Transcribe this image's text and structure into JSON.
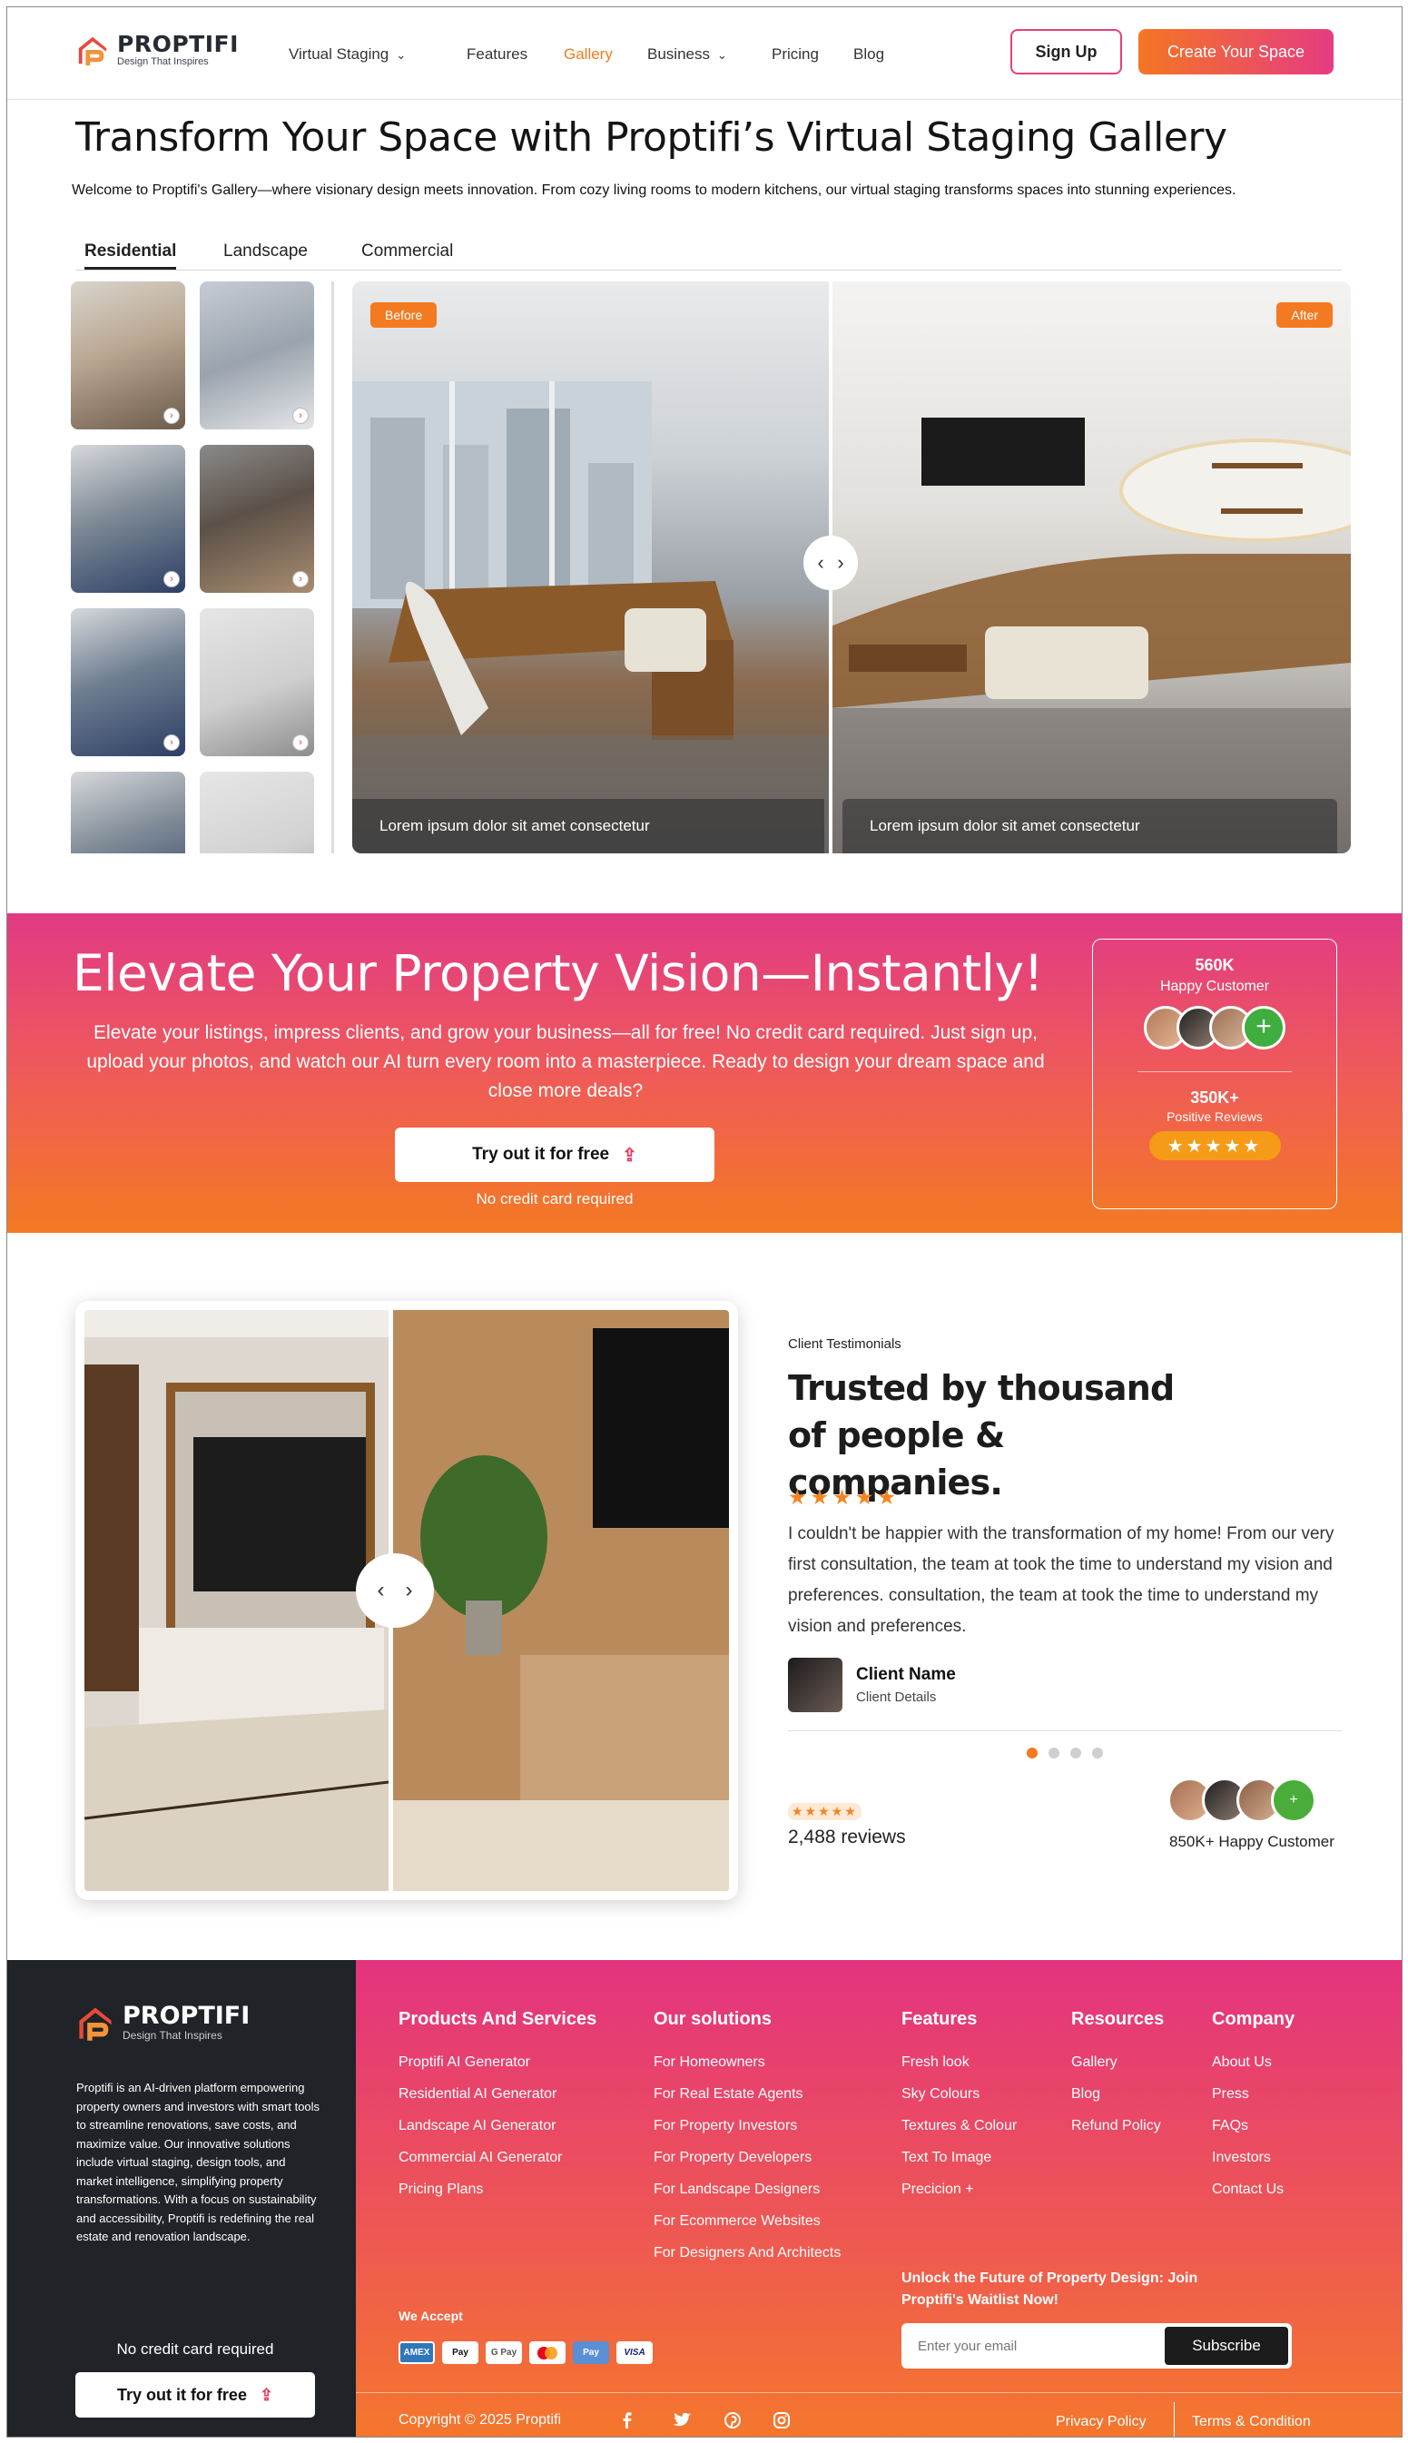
{
  "header": {
    "brand": "PROPTIFI",
    "tagline": "Design That Inspires",
    "nav": [
      {
        "label": "Virtual Staging",
        "dropdown": true
      },
      {
        "label": "Features",
        "dropdown": false
      },
      {
        "label": "Gallery",
        "dropdown": false,
        "active": true
      },
      {
        "label": "Business",
        "dropdown": true
      },
      {
        "label": "Pricing",
        "dropdown": false
      },
      {
        "label": "Blog",
        "dropdown": false
      }
    ],
    "sign_up": "Sign Up",
    "create": "Create Your Space"
  },
  "hero": {
    "title": "Transform Your Space with Proptifi’s Virtual Staging Gallery",
    "intro": "Welcome to Proptifi's Gallery—where visionary design meets innovation. From cozy living rooms to modern kitchens, our virtual staging transforms spaces into stunning experiences.",
    "tabs": [
      "Residential",
      "Landscape",
      "Commercial"
    ],
    "before": "Before",
    "after": "After",
    "caption_before": "Lorem ipsum dolor sit amet consectetur",
    "caption_after": "Lorem ipsum dolor sit amet consectetur"
  },
  "banner": {
    "title": "Elevate Your Property Vision—Instantly!",
    "body": "Elevate your listings, impress clients, and grow your business—all for free! No credit card required. Just sign up, upload your photos, and watch our AI turn every room into a masterpiece. Ready to design your dream space and close more deals?",
    "cta": "Try out it for free",
    "note": "No credit card required",
    "stat1_value": "560K",
    "stat1_label": "Happy Customer",
    "stat2_value": "350K+",
    "stat2_label": "Positive Reviews",
    "stars": "★★★★★"
  },
  "testimonials": {
    "eyebrow": "Client Testimonials",
    "title": "Trusted by thousand of people & companies.",
    "stars": "★★★★★",
    "quote": "I couldn't be happier with the transformation of my home! From our very first consultation, the team at took the time to understand my vision and preferences. consultation, the team at took the time to understand my vision and preferences.",
    "client_name": "Client Name",
    "client_details": "Client Details",
    "review_stars": "★★★★★",
    "review_count": "2,488 reviews",
    "happy": "850K+ Happy Customer"
  },
  "footer": {
    "brand": "PROPTIFI",
    "tagline": "Design That Inspires",
    "about": "Proptifi is an AI-driven platform empowering property owners and investors with smart tools to streamline renovations, save costs, and maximize value. Our innovative solutions include virtual staging, design tools, and market intelligence, simplifying property transformations. With a focus on sustainability and accessibility, Proptifi is redefining the real estate and renovation landscape.",
    "note": "No credit card required",
    "cta": "Try out it for free",
    "columns": [
      {
        "title": "Products And Services",
        "items": [
          "Proptifi AI Generator",
          "Residential AI Generator",
          "Landscape AI Generator",
          "Commercial AI Generator",
          "Pricing Plans"
        ]
      },
      {
        "title": "Our solutions",
        "items": [
          "For Homeowners",
          "For Real Estate Agents",
          "For Property Investors",
          "For Property Developers",
          "For Landscape Designers",
          "For Ecommerce Websites",
          "For Designers And Architects"
        ]
      },
      {
        "title": "Features",
        "items": [
          "Fresh look",
          "Sky Colours",
          "Textures & Colour",
          "Text To Image",
          "Precicion +"
        ]
      },
      {
        "title": "Resources",
        "items": [
          "Gallery",
          "Blog",
          "Refund Policy"
        ]
      },
      {
        "title": "Company",
        "items": [
          "About Us",
          "Press",
          "FAQs",
          "Investors",
          "Contact Us"
        ]
      }
    ],
    "we_accept": "We Accept",
    "payments": [
      "AMEX",
      "Pay",
      "G Pay",
      "MC",
      "Pay",
      "VISA"
    ],
    "waitlist": "Unlock the Future of Property Design: Join Proptifi's Waitlist Now!",
    "email_placeholder": "Enter your email",
    "subscribe": "Subscribe",
    "copyright": "Copyright © 2025 Proptifi",
    "social": [
      "facebook-icon",
      "twitter-icon",
      "pinterest-icon",
      "instagram-icon"
    ],
    "privacy": "Privacy Policy",
    "terms": "Terms & Condition"
  }
}
